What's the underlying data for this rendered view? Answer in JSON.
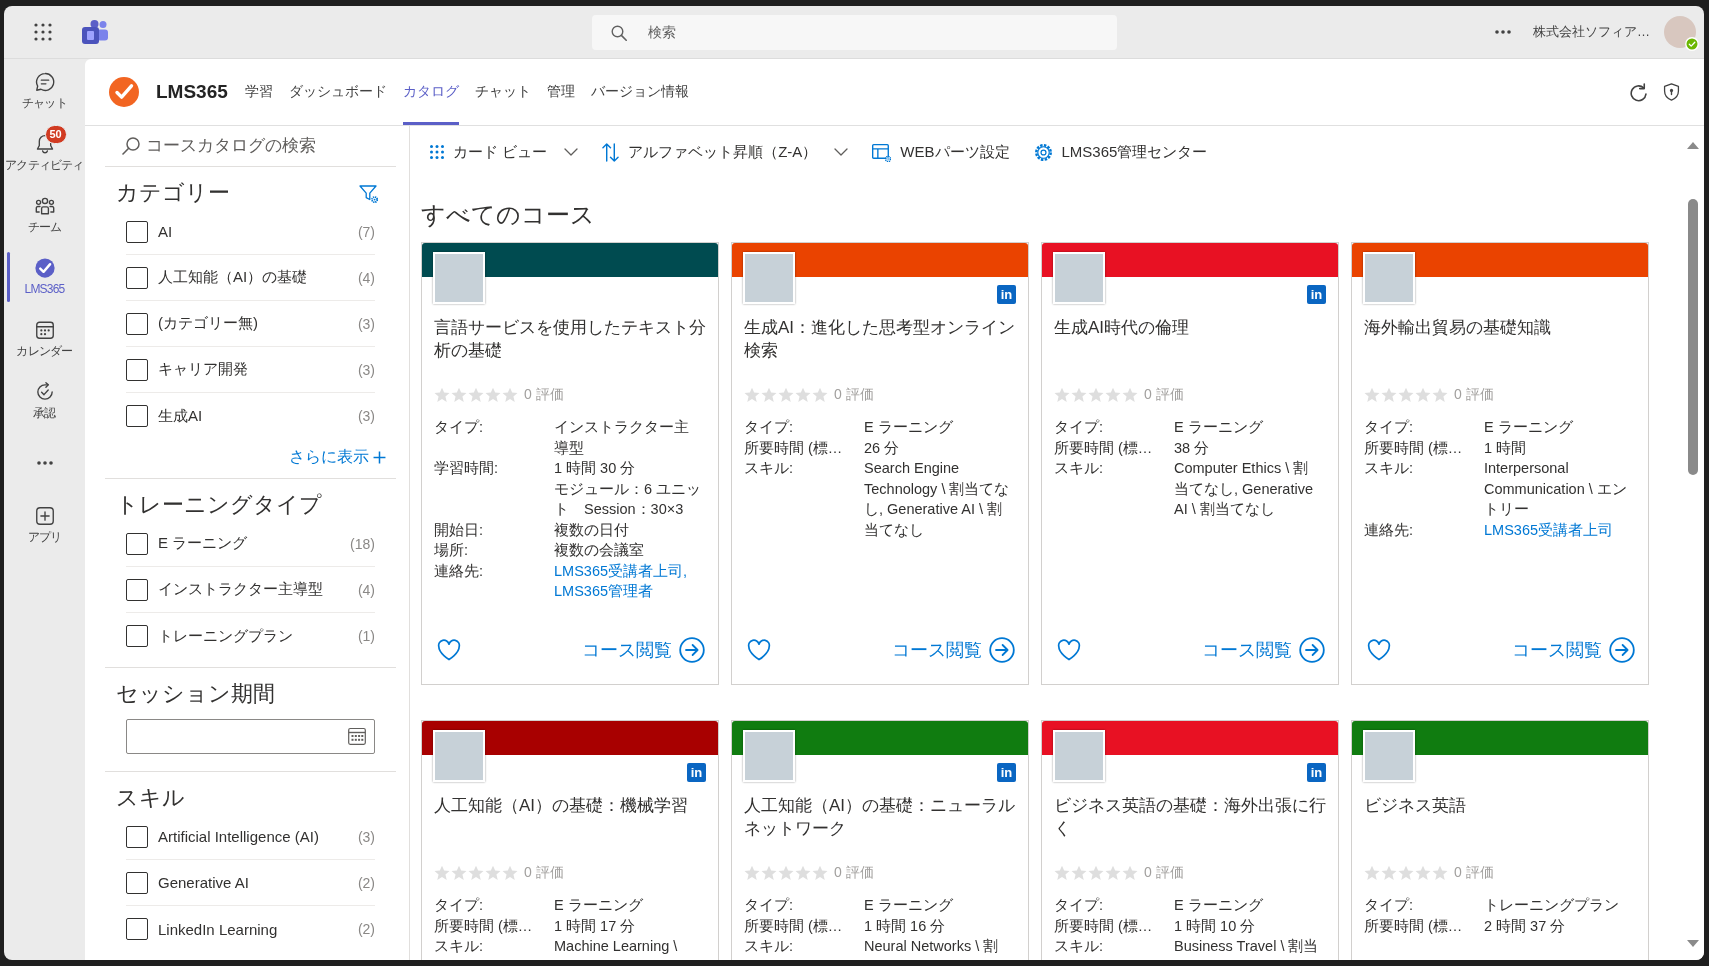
{
  "title_bar": {
    "search": {
      "placeholder": "検索"
    },
    "org_name": "株式会社ソフィア…",
    "available": true
  },
  "rail": [
    {
      "kind": "app",
      "label": "チャット",
      "selected": false
    },
    {
      "kind": "app",
      "label": "アクティビティ",
      "badge": "50",
      "selected": false
    },
    {
      "kind": "app",
      "label": "チーム",
      "selected": false
    },
    {
      "kind": "app",
      "label": "LMS365",
      "selected": true
    },
    {
      "kind": "app",
      "label": "カレンダー",
      "selected": false
    },
    {
      "kind": "app",
      "label": "承認",
      "selected": false
    },
    {
      "kind": "more",
      "selected": false
    },
    {
      "kind": "app",
      "label": "アプリ",
      "selected": false
    }
  ],
  "app_header": {
    "name": "LMS365",
    "tabs": [
      {
        "label": "学習",
        "selected": false
      },
      {
        "label": "ダッシュボード",
        "selected": false
      },
      {
        "label": "カタログ",
        "selected": true
      },
      {
        "label": "チャット",
        "selected": false
      },
      {
        "label": "管理",
        "selected": false
      },
      {
        "label": "バージョン情報",
        "selected": false
      }
    ]
  },
  "filters": {
    "search": {
      "placeholder": "コースカタログの検索"
    },
    "sections": [
      {
        "kind": "checklist",
        "title": "カテゴリー",
        "filter_button": true,
        "items": [
          {
            "label": "AI",
            "count": "(7)",
            "checked": false
          },
          {
            "label": "人工知能（AI）の基礎",
            "count": "(4)",
            "checked": false
          },
          {
            "label": "(カテゴリー無)",
            "count": "(3)",
            "checked": false
          },
          {
            "label": "キャリア開発",
            "count": "(3)",
            "checked": false
          },
          {
            "label": "生成AI",
            "count": "(3)",
            "checked": false
          }
        ],
        "more_link": "さらに表示"
      },
      {
        "kind": "checklist",
        "title": "トレーニングタイプ",
        "items": [
          {
            "label": "E ラーニング",
            "count": "(18)",
            "checked": false
          },
          {
            "label": "インストラクター主導型",
            "count": "(4)",
            "checked": false
          },
          {
            "label": "トレーニングプラン",
            "count": "(1)",
            "checked": false
          }
        ]
      },
      {
        "kind": "date",
        "title": "セッション期間"
      },
      {
        "kind": "checklist",
        "title": "スキル",
        "items": [
          {
            "label": "Artificial Intelligence (AI)",
            "count": "(3)",
            "checked": false
          },
          {
            "label": "Generative AI",
            "count": "(2)",
            "checked": false
          },
          {
            "label": "LinkedIn Learning",
            "count": "(2)",
            "checked": false
          }
        ]
      }
    ]
  },
  "toolbar": [
    {
      "kind": "view",
      "label": "カード ビュー",
      "dropdown": true
    },
    {
      "kind": "sort",
      "label": "アルファベット昇順（Z-A）",
      "dropdown": true
    },
    {
      "kind": "webparts",
      "label": "WEBパーツ設定",
      "dropdown": false
    },
    {
      "kind": "admin",
      "label": "LMS365管理センター",
      "dropdown": false
    }
  ],
  "catalog": {
    "heading": "すべてのコース",
    "courses": [
      {
        "title": "言語サービスを使用したテキスト分析の基礎",
        "color": "#004b50",
        "rating": "0 評価",
        "stars": 0,
        "details": [
          {
            "kind": "text",
            "label": "タイプ:",
            "lines": [
              "インストラクター主導型"
            ]
          },
          {
            "kind": "text",
            "label": "学習時間:",
            "lines": [
              "1 時間 30 分",
              "モジュール：6 ユニット　Session：30×3"
            ]
          },
          {
            "kind": "text",
            "label": "開始日:",
            "lines": [
              "複数の日付"
            ]
          },
          {
            "kind": "text",
            "label": "場所:",
            "lines": [
              "複数の会議室"
            ]
          },
          {
            "kind": "link",
            "label": "連絡先:",
            "lines": [
              "LMS365受講者上司, LMS365管理者"
            ]
          }
        ],
        "favorite": false,
        "action": "コース閲覧"
      },
      {
        "title": "生成AI：進化した思考型オンライン検索",
        "color": "#ea4300",
        "source_badge": "in",
        "rating": "0 評価",
        "stars": 0,
        "details": [
          {
            "kind": "text",
            "label": "タイプ:",
            "lines": [
              "E ラーニング"
            ]
          },
          {
            "kind": "text",
            "label": "所要時間 (標…",
            "lines": [
              "26 分"
            ]
          },
          {
            "kind": "text",
            "label": "スキル:",
            "lines": [
              "Search Engine Technology \\ 割当てなし, Generative AI \\ 割当てなし"
            ]
          }
        ],
        "favorite": false,
        "action": "コース閲覧"
      },
      {
        "title": "生成AI時代の倫理",
        "color": "#e81123",
        "source_badge": "in",
        "rating": "0 評価",
        "stars": 0,
        "details": [
          {
            "kind": "text",
            "label": "タイプ:",
            "lines": [
              "E ラーニング"
            ]
          },
          {
            "kind": "text",
            "label": "所要時間 (標…",
            "lines": [
              "38 分"
            ]
          },
          {
            "kind": "text",
            "label": "スキル:",
            "lines": [
              "Computer Ethics \\ 割当てなし, Generative AI \\ 割当てなし"
            ]
          }
        ],
        "favorite": false,
        "action": "コース閲覧"
      },
      {
        "title": "海外輸出貿易の基礎知識",
        "color": "#ea4300",
        "rating": "0 評価",
        "stars": 0,
        "details": [
          {
            "kind": "text",
            "label": "タイプ:",
            "lines": [
              "E ラーニング"
            ]
          },
          {
            "kind": "text",
            "label": "所要時間 (標…",
            "lines": [
              "1 時間"
            ]
          },
          {
            "kind": "text",
            "label": "スキル:",
            "lines": [
              "Interpersonal Communication \\ エントリー"
            ]
          },
          {
            "kind": "link",
            "label": "連絡先:",
            "lines": [
              "LMS365受講者上司"
            ]
          }
        ],
        "favorite": false,
        "action": "コース閲覧"
      },
      {
        "title": "人工知能（AI）の基礎：機械学習",
        "color": "#a80000",
        "source_badge": "in",
        "rating": "0 評価",
        "stars": 0,
        "details": [
          {
            "kind": "text",
            "label": "タイプ:",
            "lines": [
              "E ラーニング"
            ]
          },
          {
            "kind": "text",
            "label": "所要時間 (標…",
            "lines": [
              "1 時間 17 分"
            ]
          },
          {
            "kind": "text",
            "label": "スキル:",
            "lines": [
              "Machine Learning \\"
            ]
          }
        ]
      },
      {
        "title": "人工知能（AI）の基礎：ニューラルネットワーク",
        "color": "#107c10",
        "source_badge": "in",
        "rating": "0 評価",
        "stars": 0,
        "details": [
          {
            "kind": "text",
            "label": "タイプ:",
            "lines": [
              "E ラーニング"
            ]
          },
          {
            "kind": "text",
            "label": "所要時間 (標…",
            "lines": [
              "1 時間 16 分"
            ]
          },
          {
            "kind": "text",
            "label": "スキル:",
            "lines": [
              "Neural Networks \\ 割"
            ]
          }
        ]
      },
      {
        "title": "ビジネス英語の基礎：海外出張に行く",
        "color": "#e81123",
        "source_badge": "in",
        "rating": "0 評価",
        "stars": 0,
        "details": [
          {
            "kind": "text",
            "label": "タイプ:",
            "lines": [
              "E ラーニング"
            ]
          },
          {
            "kind": "text",
            "label": "所要時間 (標…",
            "lines": [
              "1 時間 10 分"
            ]
          },
          {
            "kind": "text",
            "label": "スキル:",
            "lines": [
              "Business Travel \\ 割当"
            ]
          }
        ]
      },
      {
        "title": "ビジネス英語",
        "color": "#107c10",
        "rating": "0 評価",
        "stars": 0,
        "details": [
          {
            "kind": "text",
            "label": "タイプ:",
            "lines": [
              "トレーニングプラン"
            ]
          },
          {
            "kind": "text",
            "label": "所要時間 (標…",
            "lines": [
              "2 時間 37 分"
            ]
          }
        ]
      }
    ]
  }
}
